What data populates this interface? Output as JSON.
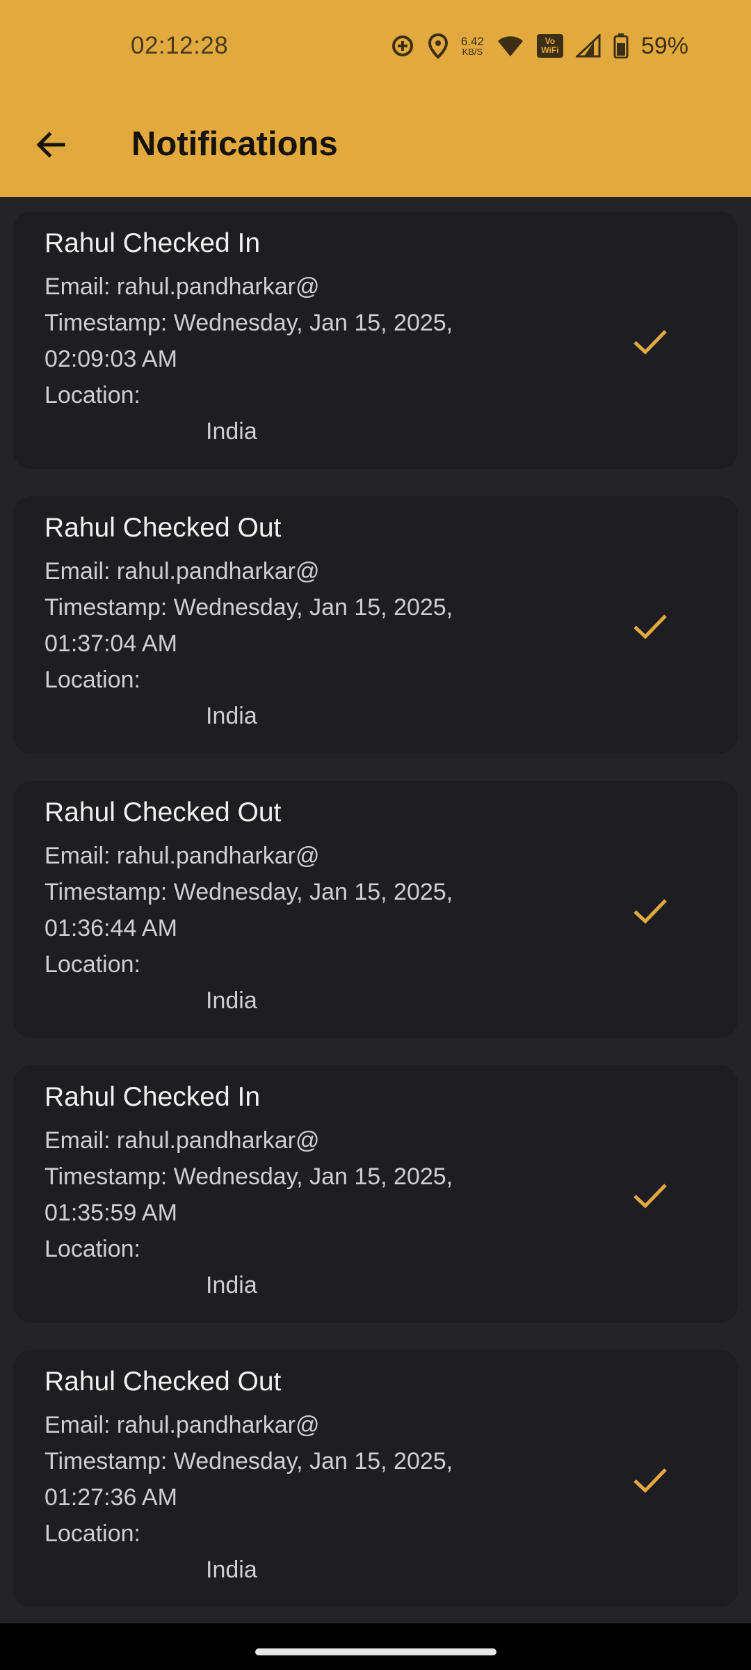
{
  "status_bar": {
    "time": "02:12:28",
    "net_speed_value": "6.42",
    "net_speed_unit": "KB/S",
    "vowifi_top": "Vo",
    "vowifi_bottom": "WiFi",
    "battery": "59%"
  },
  "header": {
    "title": "Notifications"
  },
  "colors": {
    "accent": "#E2A93E",
    "background": "#242427",
    "card": "#1e1d22"
  },
  "notifications": [
    {
      "title": "Rahul Checked In",
      "email": "Email: rahul.pandharkar@",
      "timestamp_line1": "Timestamp: Wednesday, Jan 15, 2025,",
      "timestamp_line2": "02:09:03 AM",
      "location_label": "Location:",
      "country": "India",
      "icon": "check-icon"
    },
    {
      "title": "Rahul Checked Out",
      "email": "Email: rahul.pandharkar@",
      "timestamp_line1": "Timestamp: Wednesday, Jan 15, 2025,",
      "timestamp_line2": "01:37:04 AM",
      "location_label": "Location:",
      "country": "India",
      "icon": "check-icon"
    },
    {
      "title": "Rahul Checked Out",
      "email": "Email: rahul.pandharkar@",
      "timestamp_line1": "Timestamp: Wednesday, Jan 15, 2025,",
      "timestamp_line2": "01:36:44 AM",
      "location_label": "Location:",
      "country": "India",
      "icon": "check-icon"
    },
    {
      "title": "Rahul Checked In",
      "email": "Email: rahul.pandharkar@",
      "timestamp_line1": "Timestamp: Wednesday, Jan 15, 2025,",
      "timestamp_line2": "01:35:59 AM",
      "location_label": "Location:",
      "country": "India",
      "icon": "check-icon"
    },
    {
      "title": "Rahul Checked Out",
      "email": "Email: rahul.pandharkar@",
      "timestamp_line1": "Timestamp: Wednesday, Jan 15, 2025,",
      "timestamp_line2": "01:27:36 AM",
      "location_label": "Location:",
      "country": "India",
      "icon": "check-icon"
    }
  ]
}
